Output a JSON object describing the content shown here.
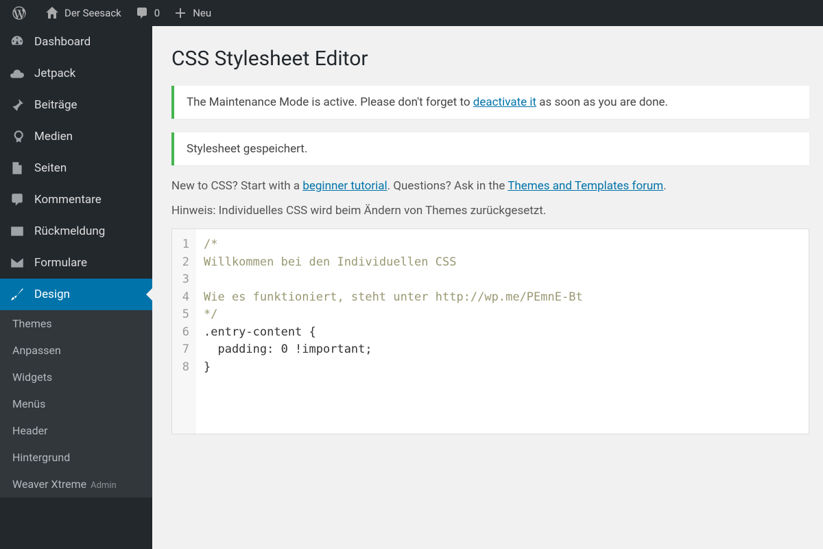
{
  "adminbar": {
    "site_name": "Der Seesack",
    "comments_count": "0",
    "new_label": "Neu"
  },
  "sidebar": {
    "items": [
      {
        "icon": "dashboard",
        "label": "Dashboard"
      },
      {
        "icon": "cloud",
        "label": "Jetpack"
      },
      {
        "icon": "pin",
        "label": "Beiträge"
      },
      {
        "icon": "media",
        "label": "Medien"
      },
      {
        "icon": "page",
        "label": "Seiten"
      },
      {
        "icon": "comment",
        "label": "Kommentare"
      },
      {
        "icon": "feedback",
        "label": "Rückmeldung"
      },
      {
        "icon": "mail",
        "label": "Formulare"
      },
      {
        "icon": "brush",
        "label": "Design",
        "active": true
      }
    ],
    "submenu": [
      "Themes",
      "Anpassen",
      "Widgets",
      "Menüs",
      "Header",
      "Hintergrund",
      "Weaver Xtreme"
    ],
    "submenu_admin_suffix": "Admin"
  },
  "page": {
    "title": "CSS Stylesheet Editor",
    "notice_maintenance_pre": "The Maintenance Mode is active. Please don't forget to ",
    "notice_maintenance_link": "deactivate it",
    "notice_maintenance_post": " as soon as you are done.",
    "notice_saved": "Stylesheet gespeichert.",
    "intro_pre": "New to CSS? Start with a ",
    "intro_link1": "beginner tutorial",
    "intro_mid": ". Questions? Ask in the ",
    "intro_link2": "Themes and Templates forum",
    "intro_post": ".",
    "hint": "Hinweis: Individuelles CSS wird beim Ändern von Themes zurückgesetzt."
  },
  "code": {
    "lines": [
      "/*",
      "Willkommen bei den Individuellen CSS",
      "",
      "Wie es funktioniert, steht unter http://wp.me/PEmnE-Bt",
      "*/",
      ".entry-content {",
      "  padding: 0 !important;",
      "}"
    ]
  }
}
